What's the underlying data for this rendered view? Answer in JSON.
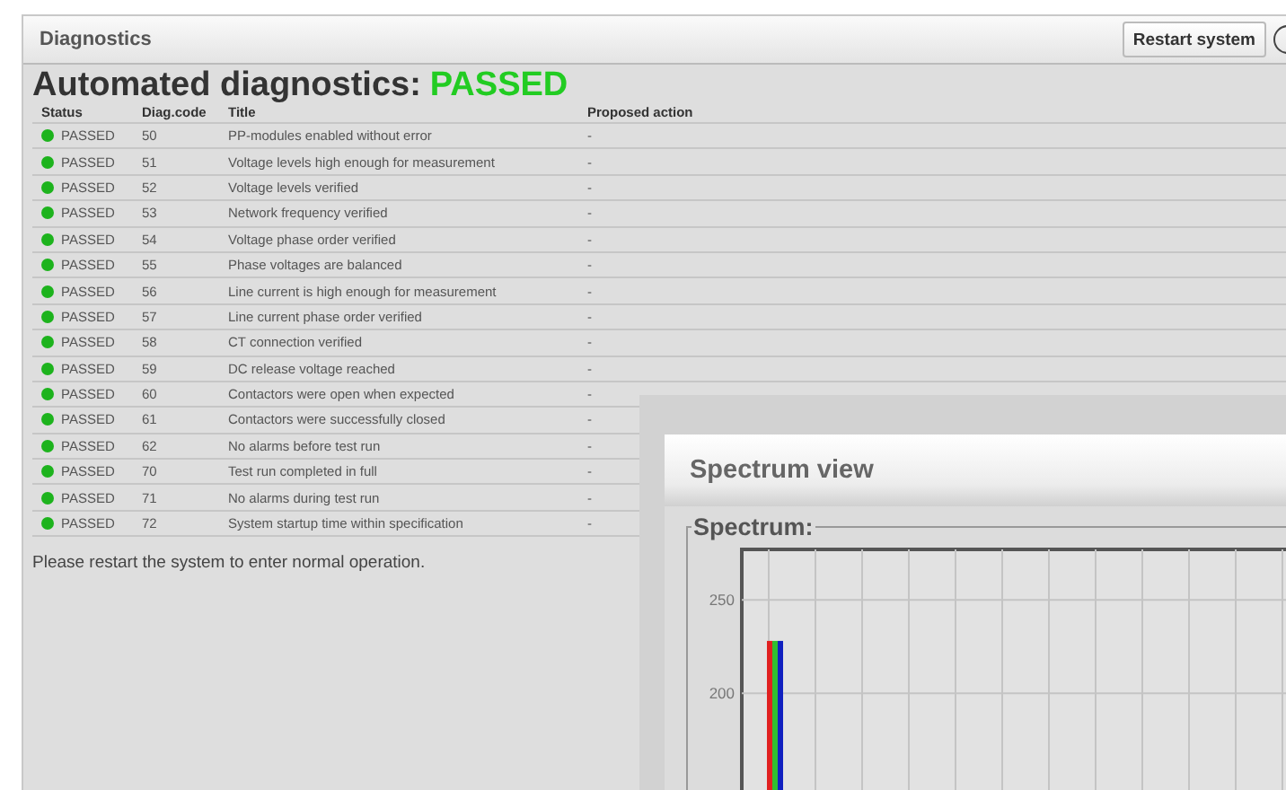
{
  "panel": {
    "title": "Diagnostics",
    "button": "Restart system"
  },
  "heading": {
    "text": "Automated diagnostics:",
    "result": "PASSED",
    "passed": true
  },
  "table": {
    "columns": [
      "Status",
      "Diag.code",
      "Title",
      "Proposed action"
    ],
    "rows": [
      {
        "status": "PASSED",
        "ok": true,
        "code": "50",
        "title": "PP-modules enabled without error",
        "action": "-"
      },
      {
        "status": "PASSED",
        "ok": true,
        "code": "51",
        "title": "Voltage levels high enough for measurement",
        "action": "-"
      },
      {
        "status": "PASSED",
        "ok": true,
        "code": "52",
        "title": "Voltage levels verified",
        "action": "-"
      },
      {
        "status": "PASSED",
        "ok": true,
        "code": "53",
        "title": "Network frequency verified",
        "action": "-"
      },
      {
        "status": "PASSED",
        "ok": true,
        "code": "54",
        "title": "Voltage phase order verified",
        "action": "-"
      },
      {
        "status": "PASSED",
        "ok": true,
        "code": "55",
        "title": "Phase voltages are balanced",
        "action": "-"
      },
      {
        "status": "PASSED",
        "ok": true,
        "code": "56",
        "title": "Line current is high enough for measurement",
        "action": "-"
      },
      {
        "status": "PASSED",
        "ok": true,
        "code": "57",
        "title": "Line current phase order verified",
        "action": "-"
      },
      {
        "status": "PASSED",
        "ok": true,
        "code": "58",
        "title": "CT connection verified",
        "action": "-"
      },
      {
        "status": "PASSED",
        "ok": true,
        "code": "59",
        "title": "DC release voltage reached",
        "action": "-"
      },
      {
        "status": "PASSED",
        "ok": true,
        "code": "60",
        "title": "Contactors were open when expected",
        "action": "-"
      },
      {
        "status": "PASSED",
        "ok": true,
        "code": "61",
        "title": "Contactors were successfully closed",
        "action": "-"
      },
      {
        "status": "PASSED",
        "ok": true,
        "code": "62",
        "title": "No alarms before test run",
        "action": "-"
      },
      {
        "status": "PASSED",
        "ok": true,
        "code": "70",
        "title": "Test run completed in full",
        "action": "-"
      },
      {
        "status": "PASSED",
        "ok": true,
        "code": "71",
        "title": "No alarms during test run",
        "action": "-"
      },
      {
        "status": "PASSED",
        "ok": true,
        "code": "72",
        "title": "System startup time within specification",
        "action": "-"
      }
    ]
  },
  "message": "Please restart the system to enter normal operation.",
  "dialog": {
    "title": "Spectrum view",
    "group": "Spectrum:",
    "chart_data": {
      "type": "bar",
      "ylim": [
        0,
        277
      ],
      "yticks": [
        200,
        250
      ],
      "series": [
        {
          "color": "#e02020",
          "values": [
            228
          ]
        },
        {
          "color": "#30c030",
          "values": [
            228
          ]
        },
        {
          "color": "#1020c0",
          "values": [
            228
          ]
        }
      ]
    }
  }
}
